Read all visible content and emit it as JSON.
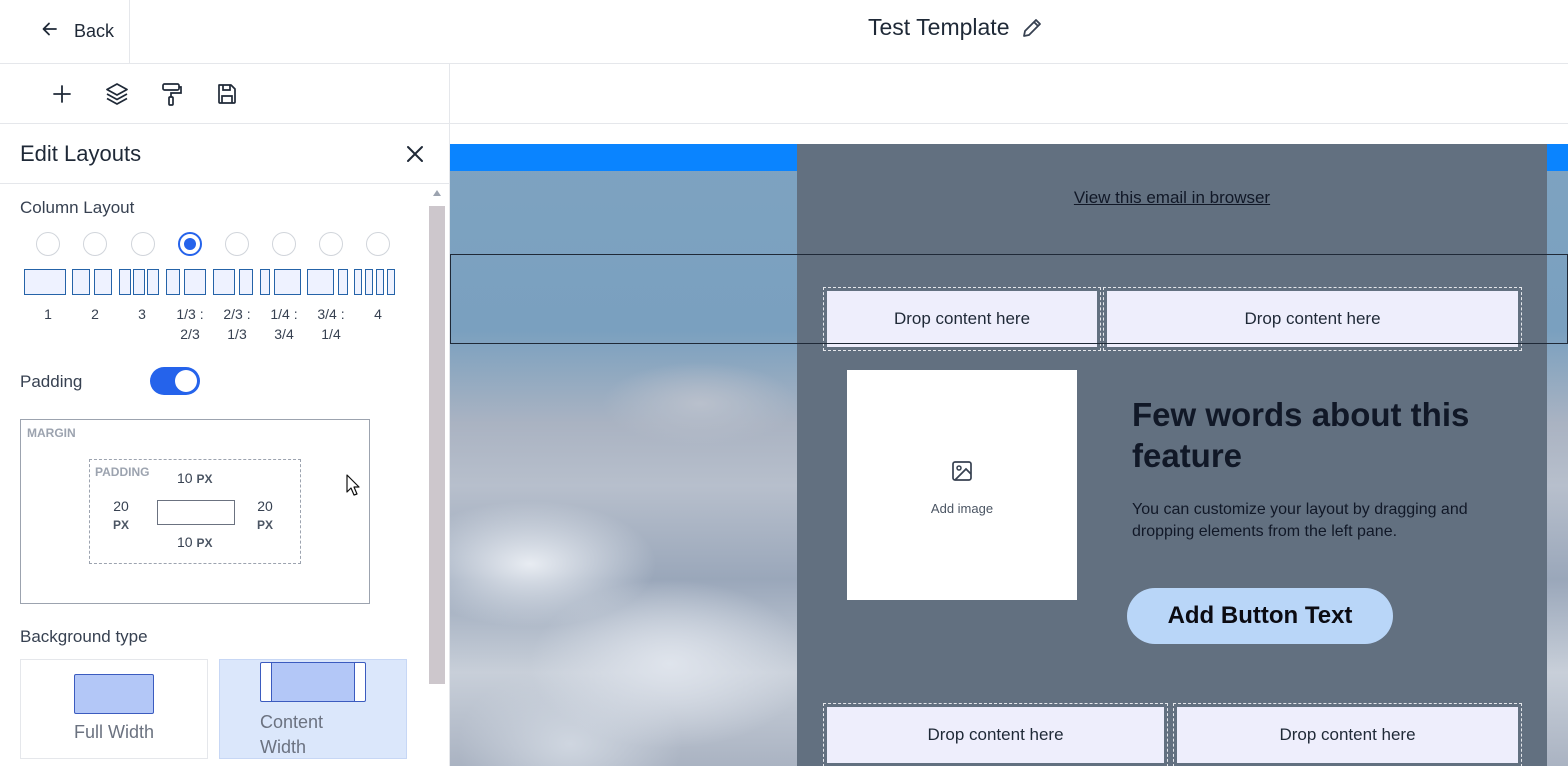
{
  "header": {
    "back_label": "Back",
    "title": "Test Template"
  },
  "toolbar": {
    "tools": [
      "plus-icon",
      "layers-icon",
      "paint-roller-icon",
      "save-icon"
    ]
  },
  "panel": {
    "title": "Edit Layouts",
    "column_layout": {
      "label": "Column Layout",
      "selected": "1/3 : 2/3",
      "options": [
        "1",
        "2",
        "3",
        "1/3 :\n2/3",
        "2/3 :\n1/3",
        "1/4 :\n3/4",
        "3/4 :\n1/4",
        "4"
      ]
    },
    "padding": {
      "label": "Padding",
      "enabled": true,
      "margin_tag": "MARGIN",
      "padding_tag": "PADDING",
      "top": "10",
      "bottom": "10",
      "left": "20",
      "right": "20",
      "unit": "PX"
    },
    "background": {
      "label": "Background type",
      "options": [
        "Full Width",
        "Content Width"
      ],
      "selected": "Content Width"
    }
  },
  "canvas": {
    "view_link": "View this email in browser",
    "drop_label": "Drop content here",
    "add_image_label": "Add image",
    "feature_title": "Few words about this feature",
    "feature_body": "You can customize your layout by dragging and dropping elements from the left pane.",
    "button_text": "Add Button Text",
    "accent": "#0a84ff",
    "email_bg": "#627080"
  }
}
